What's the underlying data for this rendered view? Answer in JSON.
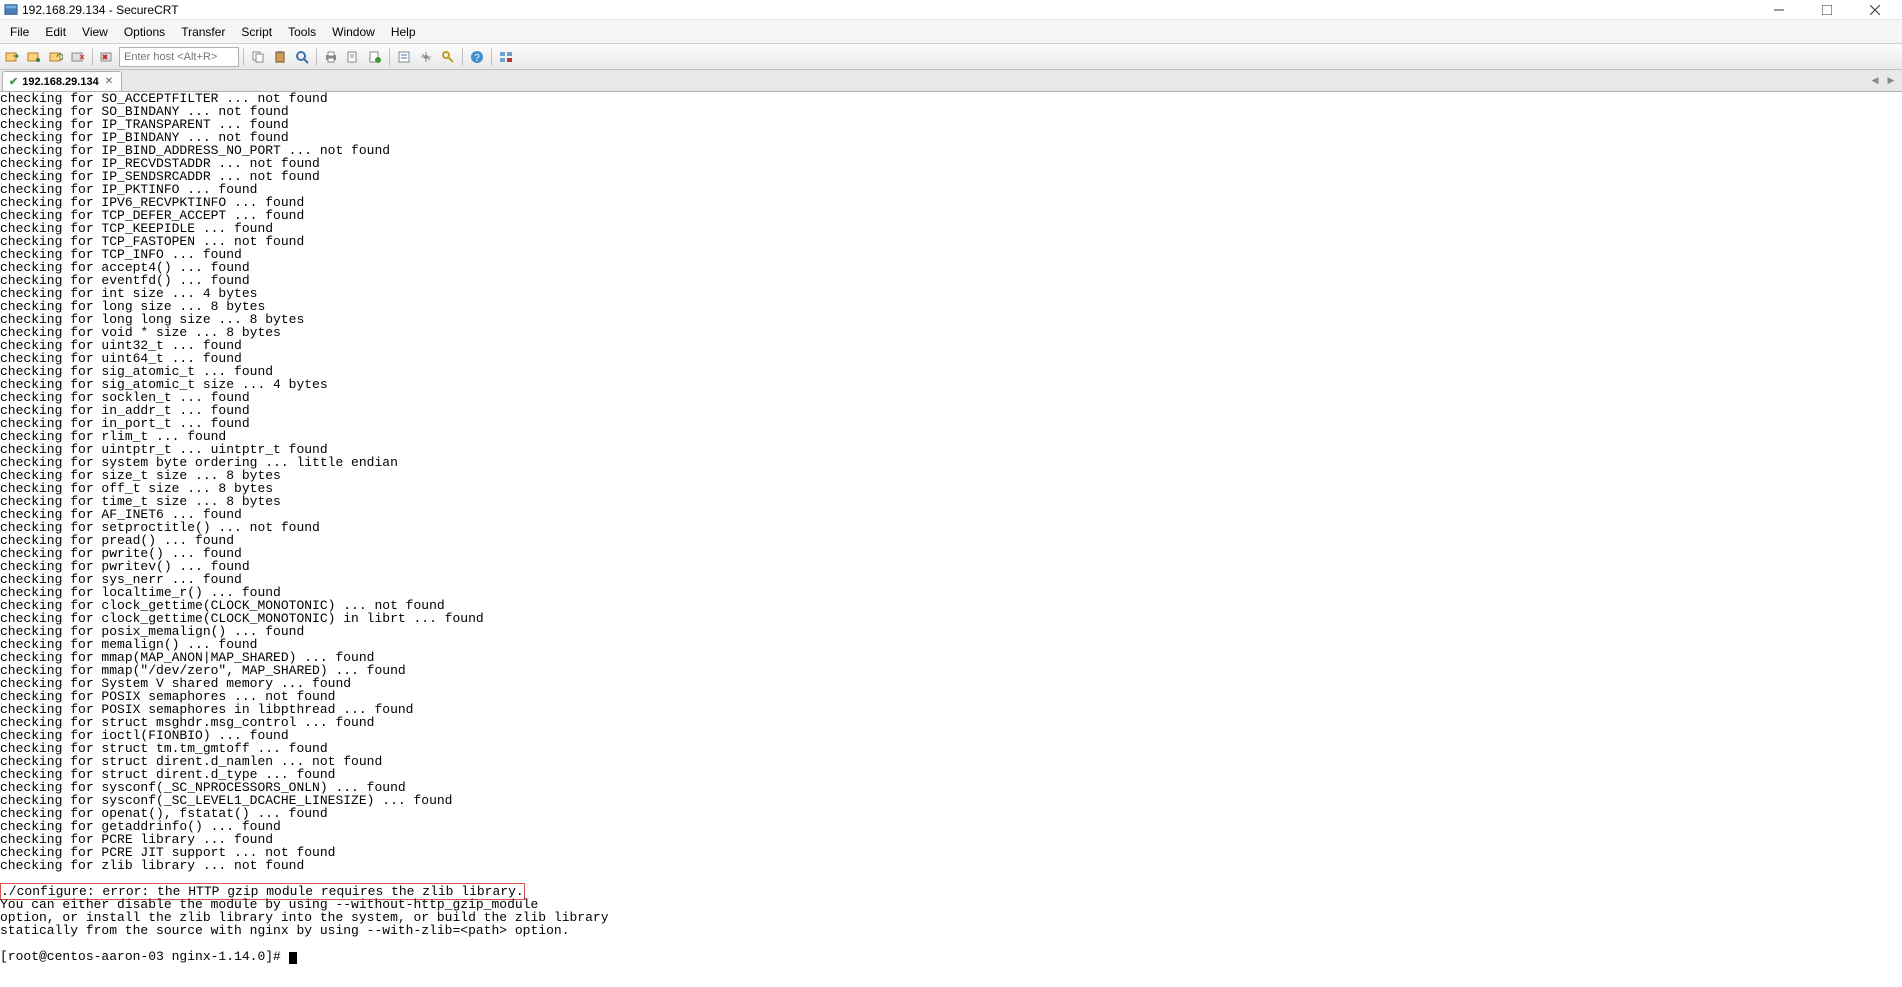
{
  "window": {
    "title": "192.168.29.134 - SecureCRT"
  },
  "menu": {
    "items": [
      "File",
      "Edit",
      "View",
      "Options",
      "Transfer",
      "Script",
      "Tools",
      "Window",
      "Help"
    ]
  },
  "toolbar": {
    "host_placeholder": "Enter host <Alt+R>"
  },
  "tab": {
    "label": "192.168.29.134"
  },
  "terminal": {
    "lines": [
      "checking for SO_ACCEPTFILTER ... not found",
      "checking for SO_BINDANY ... not found",
      "checking for IP_TRANSPARENT ... found",
      "checking for IP_BINDANY ... not found",
      "checking for IP_BIND_ADDRESS_NO_PORT ... not found",
      "checking for IP_RECVDSTADDR ... not found",
      "checking for IP_SENDSRCADDR ... not found",
      "checking for IP_PKTINFO ... found",
      "checking for IPV6_RECVPKTINFO ... found",
      "checking for TCP_DEFER_ACCEPT ... found",
      "checking for TCP_KEEPIDLE ... found",
      "checking for TCP_FASTOPEN ... not found",
      "checking for TCP_INFO ... found",
      "checking for accept4() ... found",
      "checking for eventfd() ... found",
      "checking for int size ... 4 bytes",
      "checking for long size ... 8 bytes",
      "checking for long long size ... 8 bytes",
      "checking for void * size ... 8 bytes",
      "checking for uint32_t ... found",
      "checking for uint64_t ... found",
      "checking for sig_atomic_t ... found",
      "checking for sig_atomic_t size ... 4 bytes",
      "checking for socklen_t ... found",
      "checking for in_addr_t ... found",
      "checking for in_port_t ... found",
      "checking for rlim_t ... found",
      "checking for uintptr_t ... uintptr_t found",
      "checking for system byte ordering ... little endian",
      "checking for size_t size ... 8 bytes",
      "checking for off_t size ... 8 bytes",
      "checking for time_t size ... 8 bytes",
      "checking for AF_INET6 ... found",
      "checking for setproctitle() ... not found",
      "checking for pread() ... found",
      "checking for pwrite() ... found",
      "checking for pwritev() ... found",
      "checking for sys_nerr ... found",
      "checking for localtime_r() ... found",
      "checking for clock_gettime(CLOCK_MONOTONIC) ... not found",
      "checking for clock_gettime(CLOCK_MONOTONIC) in librt ... found",
      "checking for posix_memalign() ... found",
      "checking for memalign() ... found",
      "checking for mmap(MAP_ANON|MAP_SHARED) ... found",
      "checking for mmap(\"/dev/zero\", MAP_SHARED) ... found",
      "checking for System V shared memory ... found",
      "checking for POSIX semaphores ... not found",
      "checking for POSIX semaphores in libpthread ... found",
      "checking for struct msghdr.msg_control ... found",
      "checking for ioctl(FIONBIO) ... found",
      "checking for struct tm.tm_gmtoff ... found",
      "checking for struct dirent.d_namlen ... not found",
      "checking for struct dirent.d_type ... found",
      "checking for sysconf(_SC_NPROCESSORS_ONLN) ... found",
      "checking for sysconf(_SC_LEVEL1_DCACHE_LINESIZE) ... found",
      "checking for openat(), fstatat() ... found",
      "checking for getaddrinfo() ... found",
      "checking for PCRE library ... found",
      "checking for PCRE JIT support ... not found",
      "checking for zlib library ... not found",
      ""
    ],
    "error_boxed": "./configure: error: the HTTP gzip module requires the zlib library.",
    "after_error": [
      "You can either disable the module by using --without-http_gzip_module",
      "option, or install the zlib library into the system, or build the zlib library",
      "statically from the source with nginx by using --with-zlib=<path> option.",
      ""
    ],
    "prompt": "[root@centos-aaron-03 nginx-1.14.0]# "
  }
}
